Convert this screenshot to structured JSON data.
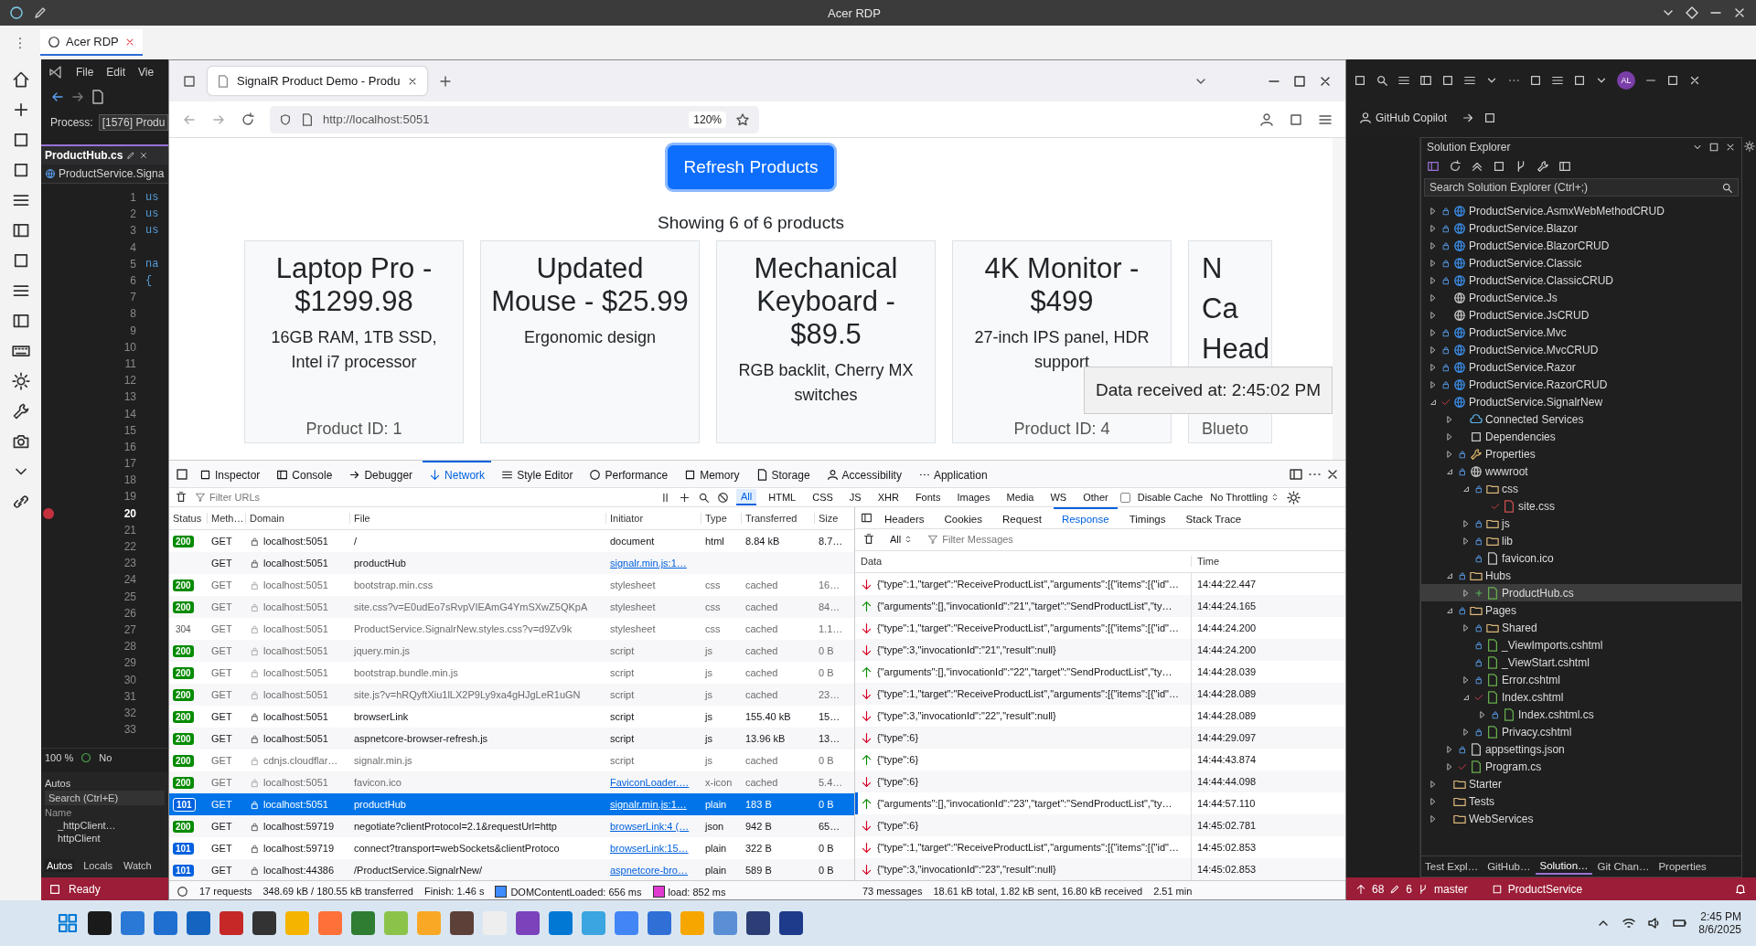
{
  "rdp_window": {
    "title": "Acer RDP",
    "tab": {
      "label": "Acer RDP",
      "selected": true
    }
  },
  "vs_left": {
    "menu": [
      "File",
      "Edit",
      "Vie"
    ],
    "process_label": "Process:",
    "process_value": "[1576] Produ",
    "doc_tab": "ProductHub.cs",
    "nav_scope": "ProductService.Signa",
    "code_lines": [
      {
        "n": "1",
        "code": "us",
        "breakpoint": false
      },
      {
        "n": "2",
        "code": "us",
        "breakpoint": false
      },
      {
        "n": "3",
        "code": "us",
        "breakpoint": false
      },
      {
        "n": "4",
        "breakpoint": false
      },
      {
        "n": "5",
        "code": "na",
        "breakpoint": false
      },
      {
        "n": "6",
        "code": "{",
        "breakpoint": false
      },
      {
        "n": "7",
        "breakpoint": false
      },
      {
        "n": "8",
        "breakpoint": false
      },
      {
        "n": "9",
        "breakpoint": false
      },
      {
        "n": "10",
        "breakpoint": false
      },
      {
        "n": "11",
        "breakpoint": false
      },
      {
        "n": "12",
        "breakpoint": false
      },
      {
        "n": "13",
        "breakpoint": false
      },
      {
        "n": "14",
        "breakpoint": false
      },
      {
        "n": "15",
        "breakpoint": false
      },
      {
        "n": "16",
        "breakpoint": false
      },
      {
        "n": "17",
        "breakpoint": false
      },
      {
        "n": "18",
        "breakpoint": false
      },
      {
        "n": "19",
        "breakpoint": false
      },
      {
        "n": "20",
        "breakpoint": true
      },
      {
        "n": "21",
        "breakpoint": false
      },
      {
        "n": "22",
        "breakpoint": false
      },
      {
        "n": "23",
        "breakpoint": false
      },
      {
        "n": "24",
        "breakpoint": false
      },
      {
        "n": "25",
        "breakpoint": false
      },
      {
        "n": "26",
        "breakpoint": false
      },
      {
        "n": "27",
        "breakpoint": false
      },
      {
        "n": "28",
        "breakpoint": false
      },
      {
        "n": "29",
        "breakpoint": false
      },
      {
        "n": "30",
        "breakpoint": false
      },
      {
        "n": "31",
        "breakpoint": false
      },
      {
        "n": "32",
        "breakpoint": false
      },
      {
        "n": "33",
        "breakpoint": false
      }
    ],
    "zoom": "100 %",
    "issues": "No",
    "autos": {
      "title": "Autos",
      "search_placeholder": "Search (Ctrl+E)",
      "column": "Name",
      "rows": [
        "_httpClient…",
        "httpClient"
      ],
      "tabs": [
        {
          "label": "Autos",
          "selected": true
        },
        {
          "label": "Locals",
          "selected": false
        },
        {
          "label": "Watch",
          "selected": false
        }
      ]
    },
    "status": "Ready"
  },
  "browser": {
    "tab_title": "SignalR Product Demo - Produ",
    "url": "http://localhost:5051",
    "zoom": "120%",
    "page": {
      "button": "Refresh Products",
      "summary": "Showing 6 of 6 products",
      "products": [
        {
          "kind": "card",
          "title": "Laptop Pro - $1299.98",
          "description": "16GB RAM, 1TB SSD, Intel i7 processor",
          "id_label": "Product ID: 1"
        },
        {
          "kind": "card",
          "title": "Updated Mouse - $25.99",
          "description": "Ergonomic design"
        },
        {
          "kind": "card",
          "title": "Mechanical Keyboard - $89.5",
          "description": "RGB backlit, Cherry MX switches"
        },
        {
          "kind": "card",
          "title": "4K Monitor - $499",
          "description": "27-inch IPS panel, HDR support",
          "id_label": "Product ID: 4"
        },
        {
          "kind": "clipped",
          "title_lines": [
            "N",
            "Ca",
            "Head"
          ],
          "description": "Blueto"
        }
      ],
      "toast": "Data received at: 2:45:02 PM"
    }
  },
  "devtools": {
    "tools": [
      {
        "kind": "inspector",
        "label": "Inspector",
        "selected": false
      },
      {
        "kind": "console",
        "label": "Console",
        "selected": false
      },
      {
        "kind": "debugger",
        "label": "Debugger",
        "selected": false
      },
      {
        "kind": "network",
        "label": "Network",
        "selected": true
      },
      {
        "kind": "style",
        "label": "Style Editor",
        "selected": false
      },
      {
        "kind": "performance",
        "label": "Performance",
        "selected": false
      },
      {
        "kind": "memory",
        "label": "Memory",
        "selected": false
      },
      {
        "kind": "storage",
        "label": "Storage",
        "selected": false
      },
      {
        "kind": "accessibility",
        "label": "Accessibility",
        "selected": false
      },
      {
        "kind": "application",
        "label": "Application",
        "selected": false
      }
    ],
    "filter_placeholder": "Filter URLs",
    "type_filters": [
      {
        "label": "All",
        "selected": true
      },
      {
        "label": "HTML",
        "selected": false
      },
      {
        "label": "CSS",
        "selected": false
      },
      {
        "label": "JS",
        "selected": false
      },
      {
        "label": "XHR",
        "selected": false
      },
      {
        "label": "Fonts",
        "selected": false
      },
      {
        "label": "Images",
        "selected": false
      },
      {
        "label": "Media",
        "selected": false
      },
      {
        "label": "WS",
        "selected": false
      },
      {
        "label": "Other",
        "selected": false
      }
    ],
    "disable_cache": {
      "label": "Disable Cache",
      "checked": false
    },
    "throttling": "No Throttling",
    "columns": [
      "Status",
      "Meth…",
      "Domain",
      "File",
      "Initiator",
      "Type",
      "Transferred",
      "Size"
    ],
    "requests": [
      {
        "kind": "ok",
        "status": "200",
        "method": "GET",
        "domain": "localhost:5051",
        "file": "/",
        "initiator": "document",
        "initiator_link": false,
        "type": "html",
        "transferred": "8.84 kB",
        "size": "8.7…",
        "cached": false,
        "selected": false
      },
      {
        "kind": "none",
        "method": "GET",
        "domain": "localhost:5051",
        "file": "productHub",
        "initiator": "signalr.min.js:1…",
        "initiator_link": true,
        "cached": false,
        "selected": false
      },
      {
        "kind": "ok",
        "status": "200",
        "method": "GET",
        "domain": "localhost:5051",
        "file": "bootstrap.min.css",
        "initiator": "stylesheet",
        "initiator_link": false,
        "type": "css",
        "transferred": "cached",
        "size": "16…",
        "cached": true,
        "selected": false
      },
      {
        "kind": "ok",
        "status": "200",
        "method": "GET",
        "domain": "localhost:5051",
        "file": "site.css?v=E0udEo7sRvpVIEAmG4YmSXwZ5QKpA",
        "initiator": "stylesheet",
        "initiator_link": false,
        "type": "css",
        "transferred": "cached",
        "size": "84…",
        "cached": true,
        "selected": false
      },
      {
        "kind": "plain",
        "status": "304",
        "method": "GET",
        "domain": "localhost:5051",
        "file": "ProductService.SignalrNew.styles.css?v=d9Zv9k",
        "initiator": "stylesheet",
        "initiator_link": false,
        "type": "css",
        "transferred": "cached",
        "size": "1.1…",
        "cached": true,
        "selected": false
      },
      {
        "kind": "ok",
        "status": "200",
        "method": "GET",
        "domain": "localhost:5051",
        "file": "jquery.min.js",
        "initiator": "script",
        "initiator_link": false,
        "type": "js",
        "transferred": "cached",
        "size": "0 B",
        "cached": true,
        "selected": false
      },
      {
        "kind": "ok",
        "status": "200",
        "method": "GET",
        "domain": "localhost:5051",
        "file": "bootstrap.bundle.min.js",
        "initiator": "script",
        "initiator_link": false,
        "type": "js",
        "transferred": "cached",
        "size": "0 B",
        "cached": true,
        "selected": false
      },
      {
        "kind": "ok",
        "status": "200",
        "method": "GET",
        "domain": "localhost:5051",
        "file": "site.js?v=hRQyftXiu1lLX2P9Ly9xa4gHJgLeR1uGN",
        "initiator": "script",
        "initiator_link": false,
        "type": "js",
        "transferred": "cached",
        "size": "23…",
        "cached": true,
        "selected": false
      },
      {
        "kind": "ok",
        "status": "200",
        "method": "GET",
        "domain": "localhost:5051",
        "file": "browserLink",
        "initiator": "script",
        "initiator_link": false,
        "type": "js",
        "transferred": "155.40 kB",
        "size": "15…",
        "cached": false,
        "selected": false
      },
      {
        "kind": "ok",
        "status": "200",
        "method": "GET",
        "domain": "localhost:5051",
        "file": "aspnetcore-browser-refresh.js",
        "initiator": "script",
        "initiator_link": false,
        "type": "js",
        "transferred": "13.96 kB",
        "size": "13…",
        "cached": false,
        "selected": false
      },
      {
        "kind": "ok",
        "status": "200",
        "method": "GET",
        "domain": "cdnjs.cloudflar…",
        "file": "signalr.min.js",
        "initiator": "script",
        "initiator_link": false,
        "type": "js",
        "transferred": "cached",
        "size": "0 B",
        "cached": true,
        "selected": false
      },
      {
        "kind": "ok",
        "status": "200",
        "method": "GET",
        "domain": "localhost:5051",
        "file": "favicon.ico",
        "initiator": "FaviconLoader.…",
        "initiator_link": true,
        "type": "x-icon",
        "transferred": "cached",
        "size": "5.4…",
        "cached": true,
        "selected": false
      },
      {
        "kind": "switch",
        "status": "101",
        "method": "GET",
        "domain": "localhost:5051",
        "file": "productHub",
        "initiator": "signalr.min.js:1…",
        "initiator_link": true,
        "type": "plain",
        "transferred": "183 B",
        "size": "0 B",
        "cached": false,
        "selected": true
      },
      {
        "kind": "ok",
        "status": "200",
        "method": "GET",
        "domain": "localhost:59719",
        "file": "negotiate?clientProtocol=2.1&requestUrl=http",
        "initiator": "browserLink:4 (…",
        "initiator_link": true,
        "type": "json",
        "transferred": "942 B",
        "size": "65…",
        "cached": false,
        "selected": false
      },
      {
        "kind": "switch",
        "status": "101",
        "method": "GET",
        "domain": "localhost:59719",
        "file": "connect?transport=webSockets&clientProtoco",
        "initiator": "browserLink:15…",
        "initiator_link": true,
        "type": "plain",
        "transferred": "322 B",
        "size": "0 B",
        "cached": false,
        "selected": false
      },
      {
        "kind": "switch",
        "status": "101",
        "method": "GET",
        "domain": "localhost:44386",
        "file": "/ProductService.SignalrNew/",
        "initiator": "aspnetcore-bro…",
        "initiator_link": true,
        "type": "plain",
        "transferred": "589 B",
        "size": "0 B",
        "cached": false,
        "selected": false
      }
    ],
    "summary": [
      "17 requests",
      "348.69 kB / 180.55 kB transferred",
      "Finish: 1.46 s",
      "DOMContentLoaded: 656 ms",
      "load: 852 ms"
    ],
    "detail_tabs": [
      {
        "label": "Headers",
        "selected": false
      },
      {
        "label": "Cookies",
        "selected": false
      },
      {
        "label": "Request",
        "selected": false
      },
      {
        "label": "Response",
        "selected": true
      },
      {
        "label": "Timings",
        "selected": false
      },
      {
        "label": "Stack Trace",
        "selected": false
      }
    ],
    "message_filter": "All",
    "message_placeholder": "Filter Messages",
    "message_columns": [
      "Data",
      "Time"
    ],
    "messages": [
      {
        "kind": "received",
        "data": "{\"type\":1,\"target\":\"ReceiveProductList\",\"arguments\":[{\"items\":[{\"id\"…",
        "time": "14:44:22.447",
        "selected": false
      },
      {
        "kind": "sent",
        "data": "{\"arguments\":[],\"invocationId\":\"21\",\"target\":\"SendProductList\",\"ty…",
        "time": "14:44:24.165",
        "selected": false
      },
      {
        "kind": "received",
        "data": "{\"type\":1,\"target\":\"ReceiveProductList\",\"arguments\":[{\"items\":[{\"id\"…",
        "time": "14:44:24.200",
        "selected": false
      },
      {
        "kind": "received",
        "data": "{\"type\":3,\"invocationId\":\"21\",\"result\":null}",
        "time": "14:44:24.200",
        "selected": false
      },
      {
        "kind": "sent",
        "data": "{\"arguments\":[],\"invocationId\":\"22\",\"target\":\"SendProductList\",\"ty…",
        "time": "14:44:28.039",
        "selected": false
      },
      {
        "kind": "received",
        "data": "{\"type\":1,\"target\":\"ReceiveProductList\",\"arguments\":[{\"items\":[{\"id\"…",
        "time": "14:44:28.089",
        "selected": false
      },
      {
        "kind": "received",
        "data": "{\"type\":3,\"invocationId\":\"22\",\"result\":null}",
        "time": "14:44:28.089",
        "selected": false
      },
      {
        "kind": "received",
        "data": "{\"type\":6}",
        "time": "14:44:29.097",
        "selected": false
      },
      {
        "kind": "sent",
        "data": "{\"type\":6}",
        "time": "14:44:43.874",
        "selected": false
      },
      {
        "kind": "received",
        "data": "{\"type\":6}",
        "time": "14:44:44.098",
        "selected": false
      },
      {
        "kind": "sent",
        "data": "{\"arguments\":[],\"invocationId\":\"23\",\"target\":\"SendProductList\",\"ty…",
        "time": "14:44:57.110",
        "selected": true
      },
      {
        "kind": "received",
        "data": "{\"type\":6}",
        "time": "14:45:02.781",
        "selected": false
      },
      {
        "kind": "received",
        "data": "{\"type\":1,\"target\":\"ReceiveProductList\",\"arguments\":[{\"items\":[{\"id\"…",
        "time": "14:45:02.853",
        "selected": false
      },
      {
        "kind": "received",
        "data": "{\"type\":3,\"invocationId\":\"23\",\"result\":null}",
        "time": "14:45:02.853",
        "selected": false
      }
    ],
    "message_summary": [
      "73 messages",
      "18.61 kB total, 1.82 kB sent, 16.80 kB received",
      "2.51 min"
    ]
  },
  "vs_right": {
    "avatar": "AL",
    "copilot": "GitHub Copilot",
    "solution_explorer": {
      "title": "Solution Explorer",
      "search_placeholder": "Search Solution Explorer (Ctrl+;)",
      "tree": [
        {
          "label": "ProductService.AsmxWebMethodCRUD",
          "kind": "project",
          "expandable": true,
          "expanded": false,
          "locked": true,
          "modified": false,
          "added": false,
          "selected": false
        },
        {
          "label": "ProductService.Blazor",
          "kind": "project",
          "expandable": true,
          "expanded": false,
          "locked": true,
          "modified": false,
          "added": false,
          "selected": false
        },
        {
          "label": "ProductService.BlazorCRUD",
          "kind": "project",
          "expandable": true,
          "expanded": false,
          "locked": true,
          "modified": false,
          "added": false,
          "selected": false
        },
        {
          "label": "ProductService.Classic",
          "kind": "project",
          "expandable": true,
          "expanded": false,
          "locked": true,
          "modified": false,
          "added": false,
          "selected": false
        },
        {
          "label": "ProductService.ClassicCRUD",
          "kind": "project",
          "expandable": true,
          "expanded": false,
          "locked": true,
          "modified": false,
          "added": false,
          "selected": false
        },
        {
          "label": "ProductService.Js",
          "kind": "web",
          "expandable": true,
          "expanded": false,
          "locked": false,
          "modified": false,
          "added": false,
          "selected": false
        },
        {
          "label": "ProductService.JsCRUD",
          "kind": "web",
          "expandable": true,
          "expanded": false,
          "locked": false,
          "modified": false,
          "added": false,
          "selected": false
        },
        {
          "label": "ProductService.Mvc",
          "kind": "project",
          "expandable": true,
          "expanded": false,
          "locked": true,
          "modified": false,
          "added": false,
          "selected": false
        },
        {
          "label": "ProductService.MvcCRUD",
          "kind": "project",
          "expandable": true,
          "expanded": false,
          "locked": true,
          "modified": false,
          "added": false,
          "selected": false
        },
        {
          "label": "ProductService.Razor",
          "kind": "project",
          "expandable": true,
          "expanded": false,
          "locked": true,
          "modified": false,
          "added": false,
          "selected": false
        },
        {
          "label": "ProductService.RazorCRUD",
          "kind": "project",
          "expandable": true,
          "expanded": false,
          "locked": true,
          "modified": false,
          "added": false,
          "selected": false
        },
        {
          "label": "ProductService.SignalrNew",
          "kind": "project",
          "expandable": true,
          "expanded": true,
          "locked": false,
          "modified": true,
          "added": false,
          "selected": false,
          "children": [
            {
              "label": "Connected Services",
              "kind": "service",
              "expandable": true,
              "expanded": false,
              "locked": false,
              "modified": false,
              "added": false,
              "selected": false
            },
            {
              "label": "Dependencies",
              "kind": "deps",
              "expandable": true,
              "expanded": false,
              "locked": false,
              "modified": false,
              "added": false,
              "selected": false
            },
            {
              "label": "Properties",
              "kind": "props",
              "expandable": true,
              "expanded": false,
              "locked": true,
              "modified": false,
              "added": false,
              "selected": false
            },
            {
              "label": "wwwroot",
              "kind": "web",
              "expandable": true,
              "expanded": true,
              "locked": true,
              "modified": false,
              "added": false,
              "selected": false,
              "children": [
                {
                  "label": "css",
                  "kind": "folder",
                  "expandable": true,
                  "expanded": true,
                  "locked": true,
                  "modified": false,
                  "added": false,
                  "selected": false,
                  "children": [
                    {
                      "label": "site.css",
                      "kind": "css",
                      "expandable": false,
                      "locked": false,
                      "modified": true,
                      "added": false,
                      "selected": false
                    }
                  ]
                },
                {
                  "label": "js",
                  "kind": "folder",
                  "expandable": true,
                  "expanded": false,
                  "locked": true,
                  "modified": false,
                  "added": false,
                  "selected": false
                },
                {
                  "label": "lib",
                  "kind": "folder",
                  "expandable": true,
                  "expanded": false,
                  "locked": true,
                  "modified": false,
                  "added": false,
                  "selected": false
                },
                {
                  "label": "favicon.ico",
                  "kind": "file",
                  "expandable": false,
                  "locked": true,
                  "modified": false,
                  "added": false,
                  "selected": false
                }
              ]
            },
            {
              "label": "Hubs",
              "kind": "folder",
              "expandable": true,
              "expanded": true,
              "locked": true,
              "modified": false,
              "added": false,
              "selected": false,
              "children": [
                {
                  "label": "ProductHub.cs",
                  "kind": "cs",
                  "expandable": true,
                  "expanded": false,
                  "locked": false,
                  "modified": false,
                  "added": true,
                  "selected": true
                }
              ]
            },
            {
              "label": "Pages",
              "kind": "folder",
              "expandable": true,
              "expanded": true,
              "locked": true,
              "modified": false,
              "added": false,
              "selected": false,
              "children": [
                {
                  "label": "Shared",
                  "kind": "folder",
                  "expandable": true,
                  "expanded": false,
                  "locked": true,
                  "modified": false,
                  "added": false,
                  "selected": false
                },
                {
                  "label": "_ViewImports.cshtml",
                  "kind": "razor",
                  "expandable": false,
                  "locked": true,
                  "modified": false,
                  "added": false,
                  "selected": false
                },
                {
                  "label": "_ViewStart.cshtml",
                  "kind": "razor",
                  "expandable": false,
                  "locked": true,
                  "modified": false,
                  "added": false,
                  "selected": false
                },
                {
                  "label": "Error.cshtml",
                  "kind": "razor",
                  "expandable": true,
                  "expanded": false,
                  "locked": true,
                  "modified": false,
                  "added": false,
                  "selected": false
                },
                {
                  "label": "Index.cshtml",
                  "kind": "razor",
                  "expandable": true,
                  "expanded": true,
                  "locked": false,
                  "modified": true,
                  "added": false,
                  "selected": false,
                  "children": [
                    {
                      "label": "Index.cshtml.cs",
                      "kind": "cs",
                      "expandable": true,
                      "expanded": false,
                      "locked": true,
                      "modified": false,
                      "added": false,
                      "selected": false
                    }
                  ]
                },
                {
                  "label": "Privacy.cshtml",
                  "kind": "razor",
                  "expandable": true,
                  "expanded": false,
                  "locked": true,
                  "modified": false,
                  "added": false,
                  "selected": false
                }
              ]
            },
            {
              "label": "appsettings.json",
              "kind": "json",
              "expandable": true,
              "expanded": false,
              "locked": true,
              "modified": false,
              "added": false,
              "selected": false
            },
            {
              "label": "Program.cs",
              "kind": "cs",
              "expandable": true,
              "expanded": false,
              "locked": false,
              "modified": true,
              "added": false,
              "selected": false
            }
          ]
        },
        {
          "label": "Starter",
          "kind": "folder",
          "expandable": true,
          "expanded": false,
          "locked": false,
          "modified": false,
          "added": false,
          "selected": false
        },
        {
          "label": "Tests",
          "kind": "folder",
          "expandable": true,
          "expanded": false,
          "locked": false,
          "modified": false,
          "added": false,
          "selected": false
        },
        {
          "label": "WebServices",
          "kind": "folder",
          "expandable": true,
          "expanded": false,
          "locked": false,
          "modified": false,
          "added": false,
          "selected": false
        }
      ],
      "bottom_tabs": [
        {
          "label": "Test Expl…",
          "selected": false
        },
        {
          "label": "GitHub…",
          "selected": false
        },
        {
          "label": "Solution…",
          "selected": true
        },
        {
          "label": "Git Chan…",
          "selected": false
        },
        {
          "label": "Properties",
          "selected": false
        }
      ]
    },
    "status": {
      "up_count": "68",
      "edit_count": "6",
      "branch": "master",
      "repo": "ProductService"
    }
  },
  "taskbar": {
    "time": "2:45 PM",
    "date": "8/6/2025"
  }
}
